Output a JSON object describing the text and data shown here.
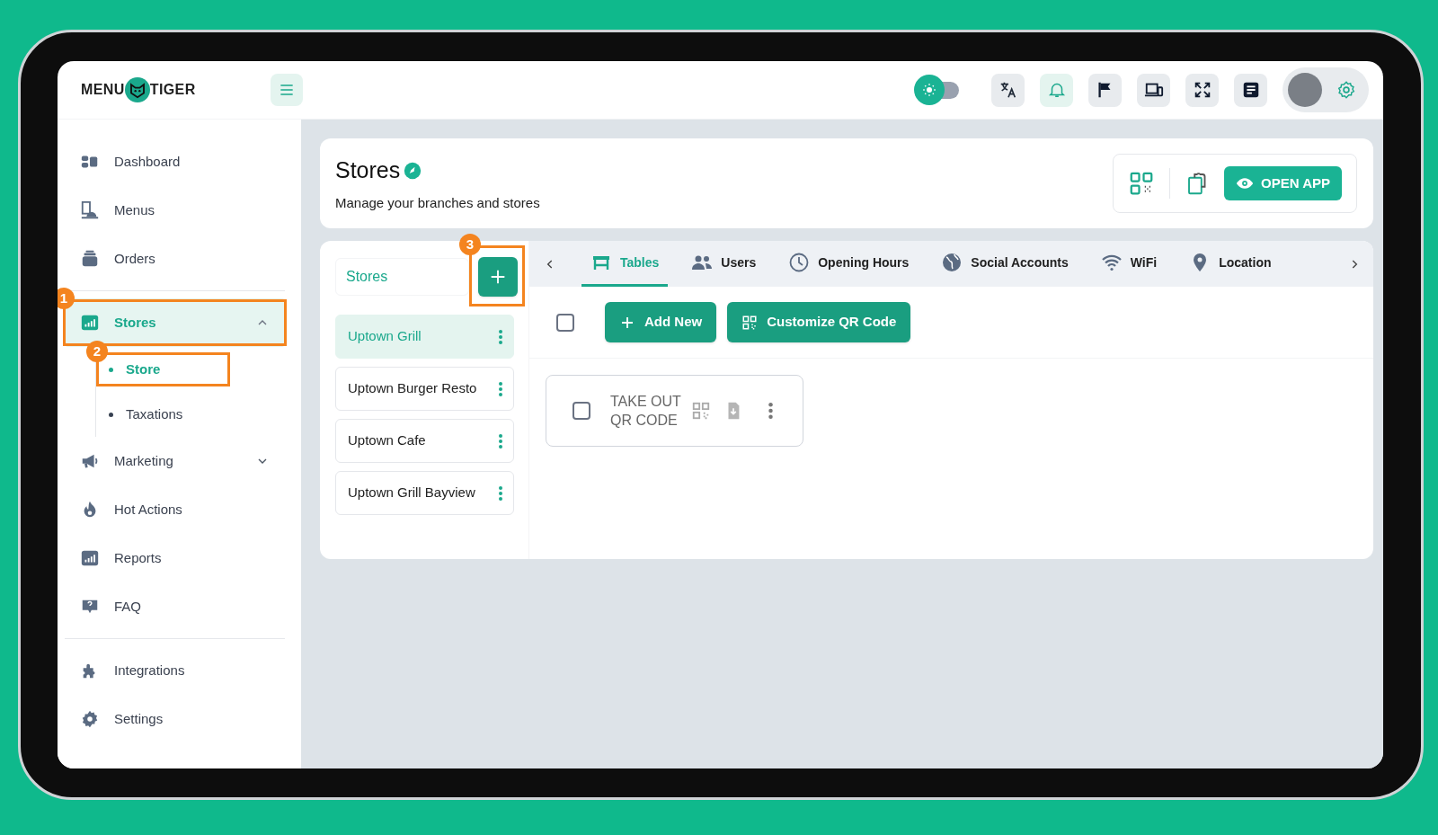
{
  "topbar": {
    "logo": {
      "left": "MENU",
      "right": "TIGER"
    },
    "theme_toggle": {
      "on": false
    }
  },
  "sidebar": {
    "sections": [
      {
        "items": [
          {
            "label": "Dashboard",
            "selected": false
          },
          {
            "label": "Menus",
            "selected": false
          },
          {
            "label": "Orders",
            "selected": false
          }
        ]
      },
      {
        "items": [
          {
            "label": "Stores",
            "selected": true,
            "expanded": true,
            "callout": "1",
            "children": [
              {
                "label": "Store",
                "selected": true,
                "callout": "2"
              },
              {
                "label": "Taxations",
                "selected": false
              }
            ]
          },
          {
            "label": "Marketing",
            "selected": false,
            "expanded": false
          },
          {
            "label": "Hot Actions",
            "selected": false
          },
          {
            "label": "Reports",
            "selected": false
          },
          {
            "label": "FAQ",
            "selected": false
          }
        ]
      },
      {
        "items": [
          {
            "label": "Integrations",
            "selected": false
          },
          {
            "label": "Settings",
            "selected": false
          }
        ]
      }
    ]
  },
  "page_header": {
    "title": "Stores",
    "subtitle": "Manage your branches and stores",
    "open_app": "OPEN APP"
  },
  "stores_panel": {
    "search": {
      "placeholder": "Stores"
    },
    "add_button": {
      "callout": "3"
    },
    "stores": [
      {
        "name": "Uptown Grill",
        "selected": true
      },
      {
        "name": "Uptown Burger Resto",
        "selected": false
      },
      {
        "name": "Uptown Cafe",
        "selected": false
      },
      {
        "name": "Uptown Grill Bayview",
        "selected": false
      }
    ]
  },
  "tabs": [
    {
      "label": "Tables",
      "selected": true
    },
    {
      "label": "Users",
      "selected": false
    },
    {
      "label": "Opening Hours",
      "selected": false
    },
    {
      "label": "Social Accounts",
      "selected": false
    },
    {
      "label": "WiFi",
      "selected": false
    },
    {
      "label": "Location",
      "selected": false
    }
  ],
  "tables_toolbar": {
    "select_all": {
      "checked": false
    },
    "buttons": [
      "Add New",
      "Customize QR Code"
    ]
  },
  "tables": [
    {
      "label": "TAKE OUT QR CODE",
      "checked": false
    }
  ]
}
